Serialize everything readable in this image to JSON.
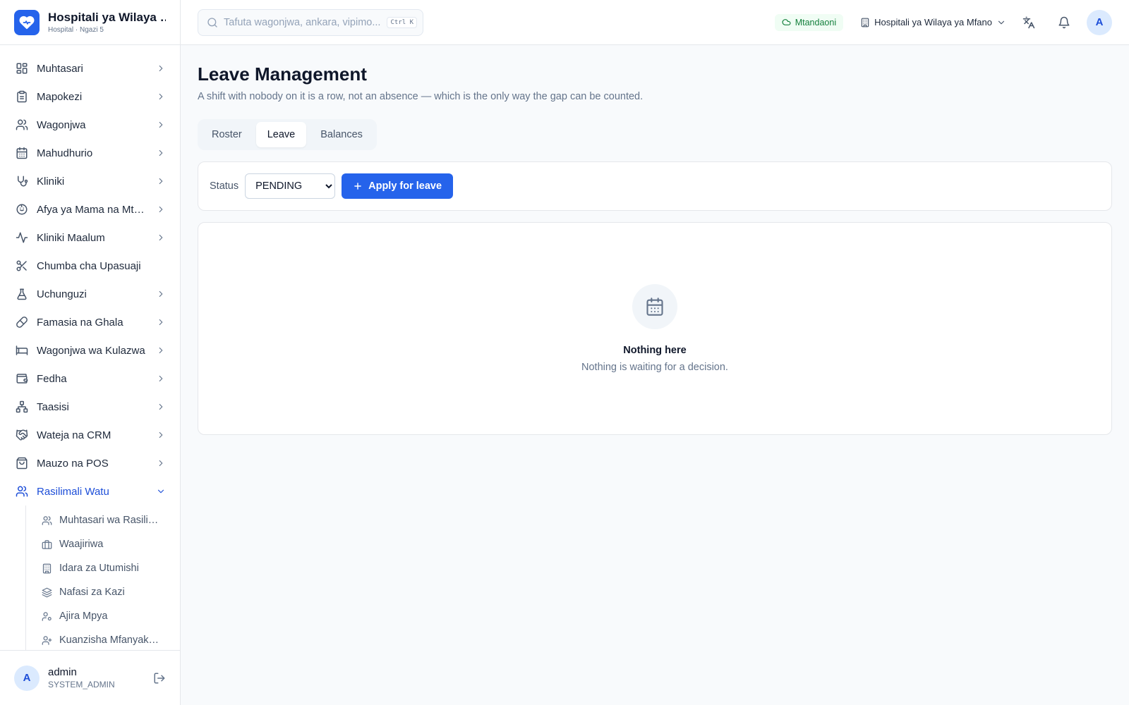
{
  "brand": {
    "title": "Hospitali ya Wilaya ya Mfano",
    "subtitle": "Hospital · Ngazi 5",
    "accent": "#2563eb"
  },
  "sidebar": {
    "items": [
      {
        "label": "Muhtasari",
        "icon": "dashboard-icon"
      },
      {
        "label": "Mapokezi",
        "icon": "clipboard-icon"
      },
      {
        "label": "Wagonjwa",
        "icon": "users-icon"
      },
      {
        "label": "Mahudhurio",
        "icon": "calendar-icon"
      },
      {
        "label": "Kliniki",
        "icon": "stethoscope-icon"
      },
      {
        "label": "Afya ya Mama na Mtoto",
        "icon": "baby-icon"
      },
      {
        "label": "Kliniki Maalum",
        "icon": "activity-icon"
      },
      {
        "label": "Chumba cha Upasuaji",
        "icon": "scissors-icon"
      },
      {
        "label": "Uchunguzi",
        "icon": "flask-icon"
      },
      {
        "label": "Famasia na Ghala",
        "icon": "pill-icon"
      },
      {
        "label": "Wagonjwa wa Kulazwa",
        "icon": "bed-icon"
      },
      {
        "label": "Fedha",
        "icon": "wallet-icon"
      },
      {
        "label": "Taasisi",
        "icon": "network-icon"
      },
      {
        "label": "Wateja na CRM",
        "icon": "handshake-icon"
      },
      {
        "label": "Mauzo na POS",
        "icon": "shopping-bag-icon"
      },
      {
        "label": "Rasilimali Watu",
        "icon": "users-icon"
      }
    ],
    "sub_items": [
      {
        "label": "Muhtasari wa Rasilimali Watu",
        "icon": "users-icon"
      },
      {
        "label": "Waajiriwa",
        "icon": "briefcase-icon"
      },
      {
        "label": "Idara za Utumishi",
        "icon": "building-icon"
      },
      {
        "label": "Nafasi za Kazi",
        "icon": "layers-icon"
      },
      {
        "label": "Ajira Mpya",
        "icon": "user-cog-icon"
      },
      {
        "label": "Kuanzisha Mfanyakazi",
        "icon": "user-plus-icon"
      }
    ]
  },
  "user": {
    "initial": "A",
    "name": "admin",
    "role": "SYSTEM_ADMIN"
  },
  "topbar": {
    "search_placeholder": "Tafuta wagonjwa, ankara, vipimo...",
    "shortcut": "Ctrl K",
    "status": "Mtandaoni",
    "status_color": "#15803d",
    "facility": "Hospitali ya Wilaya ya Mfano",
    "avatar_initial": "A"
  },
  "page": {
    "title": "Leave Management",
    "subtitle": "A shift with nobody on it is a row, not an absence — which is the only way the gap can be counted.",
    "tabs": [
      "Roster",
      "Leave",
      "Balances"
    ],
    "active_tab": "Leave"
  },
  "filter": {
    "label": "Status",
    "selected": "PENDING",
    "apply_label": "Apply for leave"
  },
  "empty": {
    "title": "Nothing here",
    "message": "Nothing is waiting for a decision."
  }
}
